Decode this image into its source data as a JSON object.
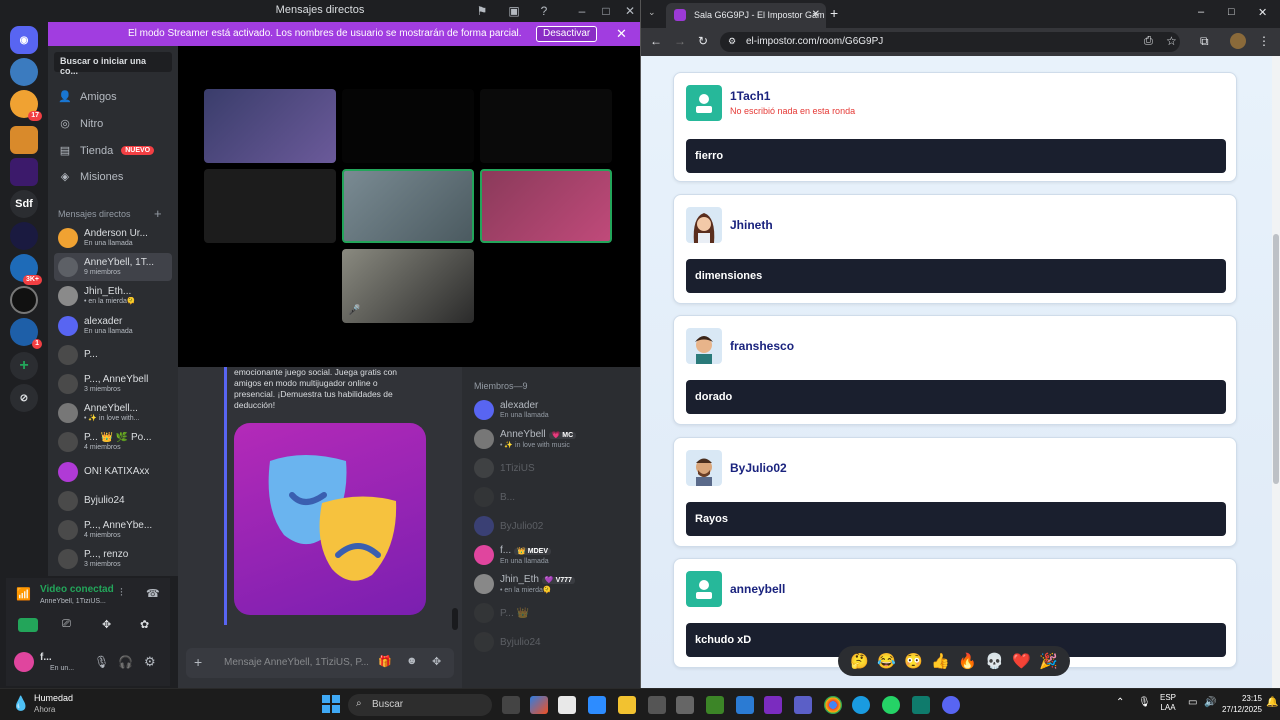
{
  "discord": {
    "window_title": "Mensajes directos",
    "banner": {
      "text": "El modo Streamer está activado. Los nombres de usuario se mostrarán de forma parcial.",
      "button": "Desactivar"
    },
    "search_placeholder": "Buscar o iniciar una co...",
    "nav": [
      {
        "label": "Amigos",
        "icon": "friends-icon"
      },
      {
        "label": "Nitro",
        "icon": "nitro-icon"
      },
      {
        "label": "Tienda",
        "icon": "shop-icon",
        "badge": "NUEVO"
      },
      {
        "label": "Misiones",
        "icon": "quests-icon"
      }
    ],
    "dm_header": "Mensajes directos",
    "dms": [
      {
        "name": "Anderson Ur...",
        "status": "En una llamada",
        "color": "#f0a232"
      },
      {
        "name": "AnneYbell, 1T...",
        "status": "9 miembros",
        "color": "#5d6066",
        "selected": true
      },
      {
        "name": "Jhin_Eth...",
        "status": "• en la mierda🫠",
        "color": "#8a8a8a"
      },
      {
        "name": "alexader",
        "status": "En una llamada",
        "color": "#5865f2"
      },
      {
        "name": "P...",
        "status": "",
        "color": "#4a4a4a"
      },
      {
        "name": "P..., AnneYbell",
        "status": "3 miembros",
        "color": "#4a4a4a"
      },
      {
        "name": "AnneYbell...",
        "status": "• ✨ in love with...",
        "color": "#777"
      },
      {
        "name": "P... 👑 🌿 Po...",
        "status": "4 miembros",
        "color": "#4a4a4a"
      },
      {
        "name": "ON! KATIXAxx",
        "status": "",
        "color": "#b03ad6"
      },
      {
        "name": "Byjulio24",
        "status": "",
        "color": "#4a4a4a"
      },
      {
        "name": "P..., AnneYbe...",
        "status": "4 miembros",
        "color": "#4a4a4a"
      },
      {
        "name": "P..., renzo",
        "status": "3 miembros",
        "color": "#4a4a4a"
      }
    ],
    "server_badges": {
      "s2": "17",
      "s7": "3K+",
      "s9": "1"
    },
    "server_label": "Sdf",
    "voice": {
      "title": "Video conectad...",
      "channel": "AnneYbell, 1TiziUS..."
    },
    "user": {
      "name": "f...",
      "status": "En un..."
    },
    "chat_text": "emocionante juego social. Juega gratis con amigos en modo multijugador online o presencial. ¡Demuestra tus habilidades de deducción!",
    "members_header": "Miembros—9",
    "members": [
      {
        "name": "alexader",
        "status": "En una llamada",
        "color": "#5865f2"
      },
      {
        "name": "AnneYbell",
        "tag": "💗 MC",
        "status": "• ✨ in love with music",
        "color": "#777"
      },
      {
        "name": "1TiziUS",
        "status": "",
        "color": "#666",
        "dim": true
      },
      {
        "name": "B...",
        "status": "",
        "color": "#444",
        "dim": true
      },
      {
        "name": "ByJulio02",
        "status": "",
        "color": "#5865f2",
        "dim": true
      },
      {
        "name": "f...",
        "tag": "👑 MDEV",
        "status": "En una llamada",
        "color": "#e0459e"
      },
      {
        "name": "Jhin_Eth",
        "tag": "💜 V777",
        "status": "• en la mierda🫠",
        "color": "#888"
      },
      {
        "name": "P... 👑",
        "status": "",
        "color": "#444",
        "dim": true
      },
      {
        "name": "Byjulio24",
        "status": "",
        "color": "#444",
        "dim": true
      }
    ],
    "message_placeholder": "Mensaje AnneYbell, 1TiziUS, P..."
  },
  "chrome": {
    "tab_title": "Sala G6G9PJ - El Impostor Gam",
    "url": "el-impostor.com/room/G6G9PJ",
    "players": [
      {
        "name": "1Tach1",
        "note": "No escribió nada en esta ronda",
        "word": "fierro",
        "avatar": "generic"
      },
      {
        "name": "Jhineth",
        "note": "",
        "word": "dimensiones",
        "avatar": "girl"
      },
      {
        "name": "franshesco",
        "note": "",
        "word": "dorado",
        "avatar": "boy"
      },
      {
        "name": "ByJulio02",
        "note": "",
        "word": "Rayos",
        "avatar": "man"
      },
      {
        "name": "anneybell",
        "note": "",
        "word": "kchudo xD",
        "avatar": "generic"
      }
    ],
    "reactions": [
      "🤔",
      "😂",
      "😳",
      "👍",
      "🔥",
      "💀",
      "❤️",
      "🎉"
    ]
  },
  "taskbar": {
    "weather_title": "Humedad",
    "weather_sub": "Ahora",
    "search": "Buscar",
    "lang": "ESP",
    "lang2": "LAA",
    "time": "23:15",
    "date": "27/12/2025"
  }
}
